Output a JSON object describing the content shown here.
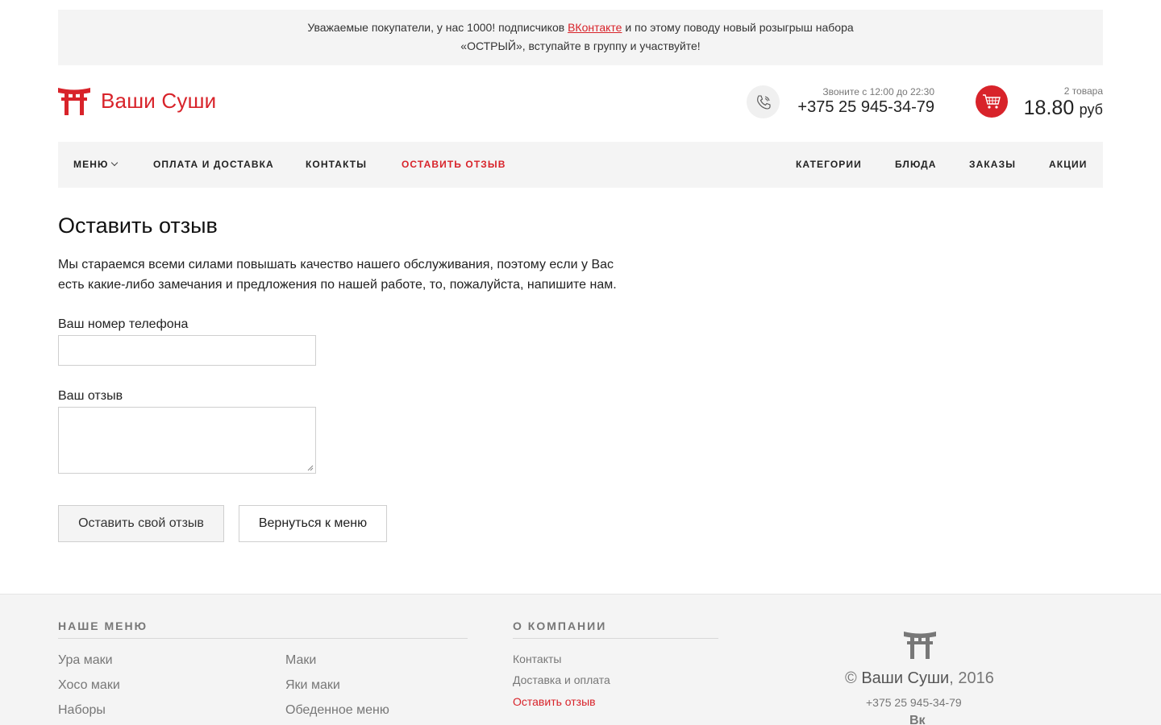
{
  "announcement": {
    "text_before": "Уважаемые покупатели, у нас 1000! подписчиков ",
    "link": "ВКонтакте",
    "text_after": " и по этому поводу новый розыгрыш набора",
    "line2": "«ОСТРЫЙ», вступайте в группу и участвуйте!"
  },
  "brand": {
    "name": "Ваши Суши",
    "logo_icon": "torii-gate-icon",
    "color": "#d8232a"
  },
  "contact": {
    "hours": "Звоните с 12:00 до 22:30",
    "phone": "+375 25 945-34-79",
    "icon": "phone-icon"
  },
  "cart": {
    "count": "2 товара",
    "total": "18.80",
    "currency": "руб",
    "icon": "cart-icon"
  },
  "nav": {
    "left": [
      {
        "label": "МЕНЮ",
        "has_dropdown": true
      },
      {
        "label": "ОПЛАТА И ДОСТАВКА"
      },
      {
        "label": "КОНТАКТЫ"
      },
      {
        "label": "ОСТАВИТЬ ОТЗЫВ",
        "active": true
      }
    ],
    "right": [
      {
        "label": "КАТЕГОРИИ"
      },
      {
        "label": "БЛЮДА"
      },
      {
        "label": "ЗАКАЗЫ"
      },
      {
        "label": "АКЦИИ"
      }
    ]
  },
  "page": {
    "title": "Оставить отзыв",
    "intro_line1": "Мы стараемся всеми силами повышать качество нашего обслуживания, поэтому если у Вас",
    "intro_line2": "есть какие-либо замечания и предложения по нашей работе, то, пожалуйста, напишите нам."
  },
  "form": {
    "phone_label": "Ваш номер телефона",
    "phone_value": "",
    "review_label": "Ваш отзыв",
    "review_value": "",
    "submit_label": "Оставить свой отзыв",
    "back_label": "Вернуться к меню"
  },
  "footer": {
    "menu_heading": "НАШЕ МЕНЮ",
    "menu_col1": [
      "Ура маки",
      "Хосо маки",
      "Наборы"
    ],
    "menu_col2": [
      "Маки",
      "Яки маки",
      "Обеденное меню"
    ],
    "about_heading": "О КОМПАНИИ",
    "about_links": [
      {
        "label": "Контакты"
      },
      {
        "label": "Доставка и оплата"
      },
      {
        "label": "Оставить отзыв",
        "active": true
      }
    ],
    "copyright_symbol": "©",
    "brand": "Ваши Суши",
    "year": ", 2016",
    "phone": "+375 25 945-34-79",
    "social_icon": "vk-icon",
    "social_label": "Вк"
  }
}
